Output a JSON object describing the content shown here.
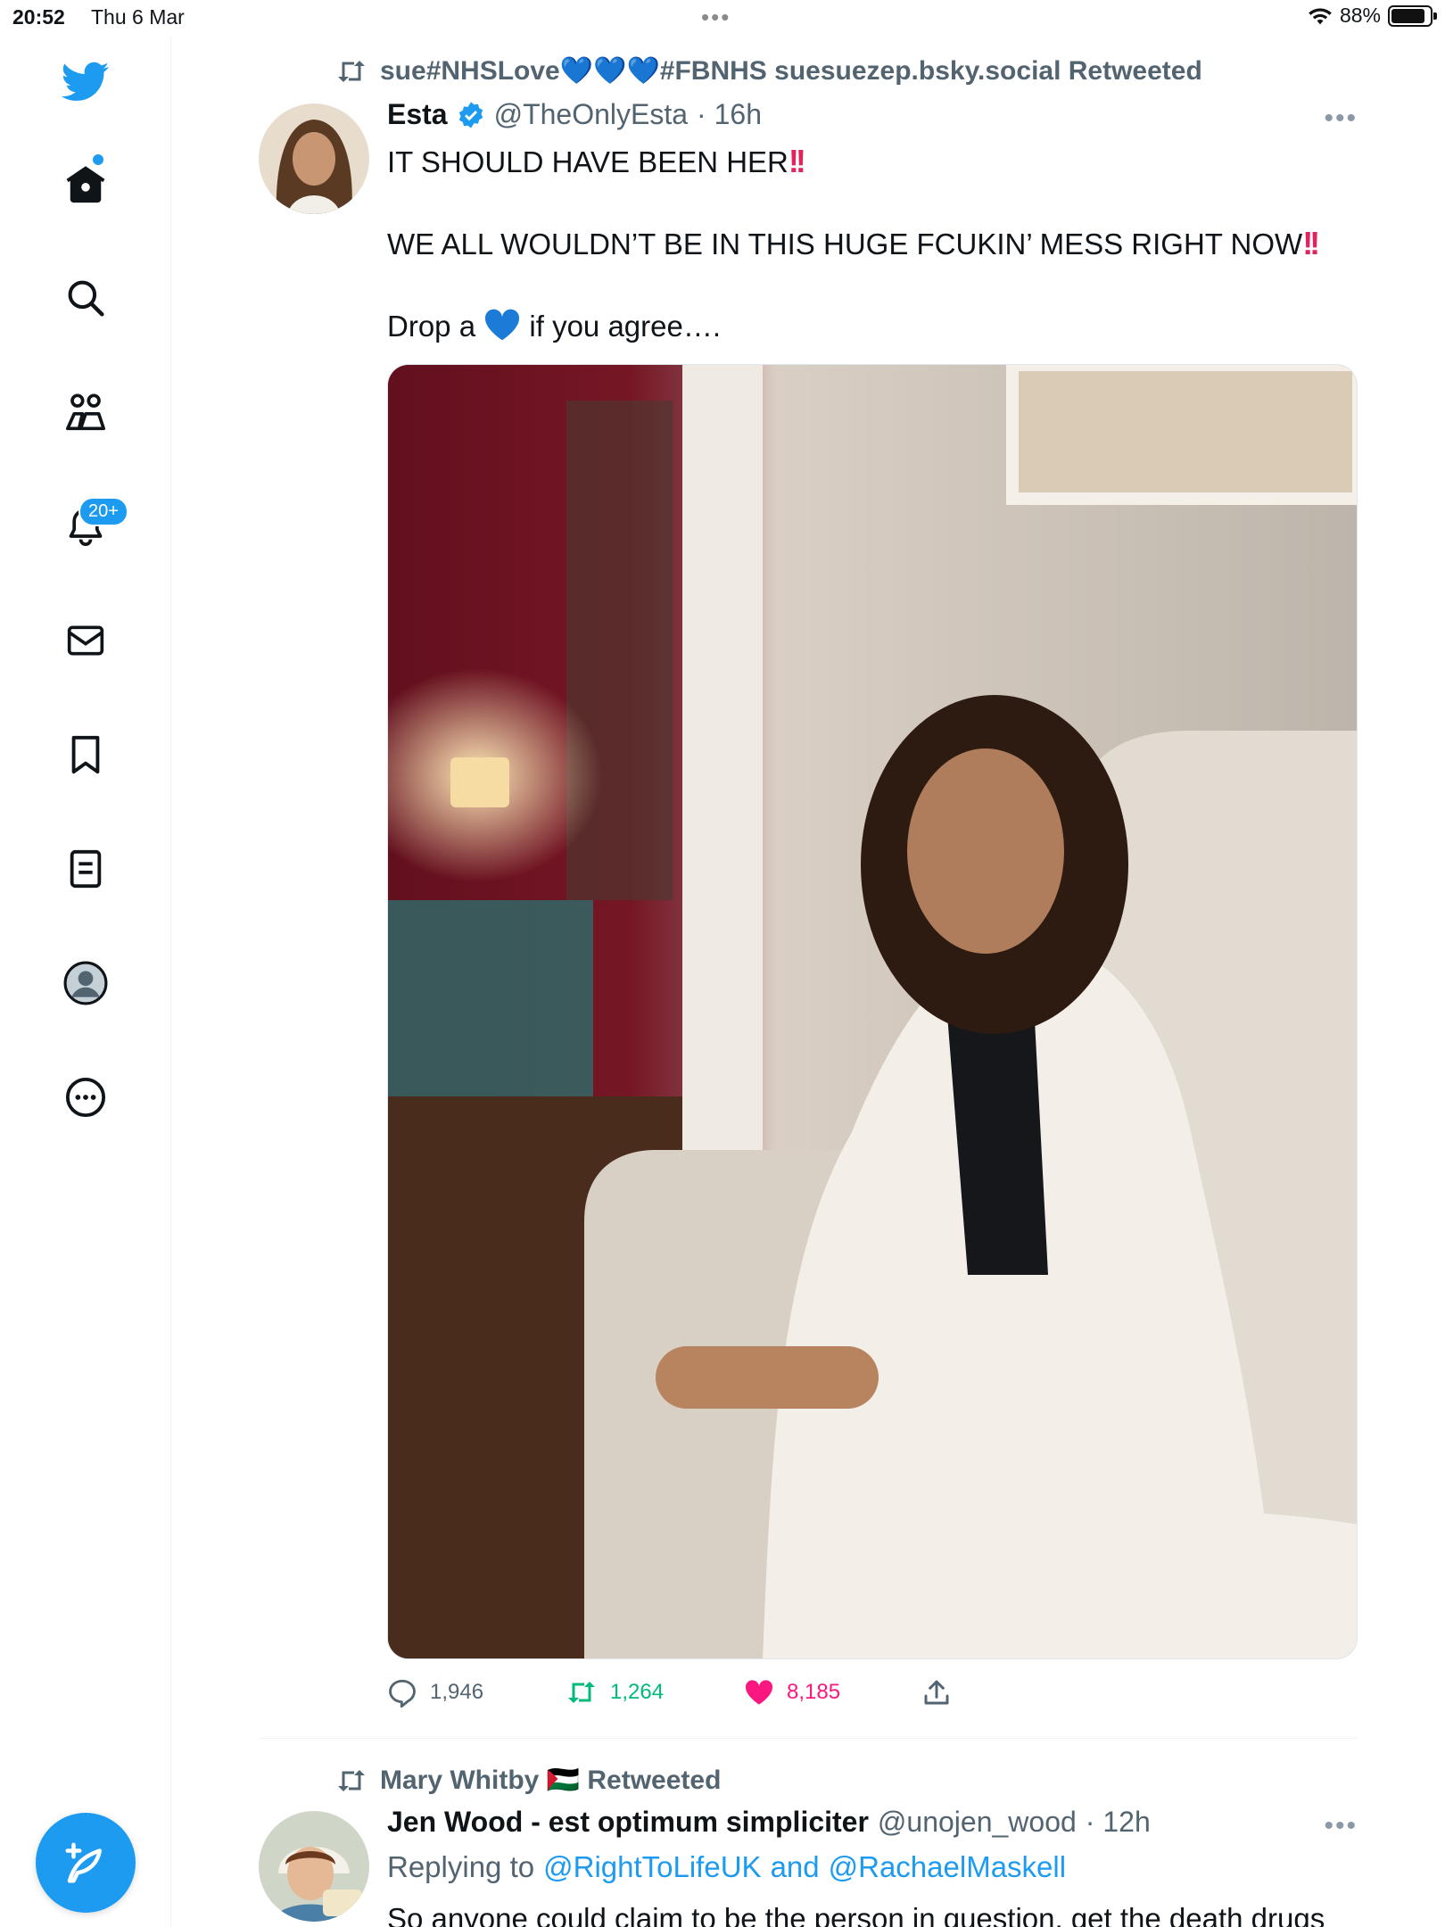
{
  "status_bar": {
    "time": "20:52",
    "date": "Thu 6 Mar",
    "battery": "88%",
    "battery_level": 0.88
  },
  "sidebar": {
    "notifications_badge": "20+",
    "items": [
      "home-icon",
      "search-icon",
      "communities-icon",
      "notifications-icon",
      "messages-icon",
      "bookmarks-icon",
      "lists-icon",
      "profile-icon",
      "more-icon"
    ]
  },
  "tweets": [
    {
      "retweeted_by": "sue#NHSLove💙💙💙#FBNHS suesuezep.bsky.social Retweeted",
      "name": "Esta",
      "handle": "@TheOnlyEsta",
      "time": "· 16h",
      "line1": "IT SHOULD HAVE BEEN HER",
      "line2": "WE ALL WOULDN’T BE IN THIS HUGE FCUKIN’ MESS RIGHT NOW",
      "line3_a": "Drop a",
      "line3_b": "if you agree….",
      "replies": "1,946",
      "retweets": "1,264",
      "likes": "8,185"
    },
    {
      "retweeted_by": "Mary Whitby 🇵🇸 Retweeted",
      "name": "Jen Wood - est optimum simpliciter",
      "handle": "@unojen_wood",
      "time": "· 12h",
      "replying_prefix": "Replying to",
      "replying_to_1": "@RightToLifeUK",
      "replying_and": "and",
      "replying_to_2": "@RachaelMaskell",
      "text": "So anyone could claim to be the person in question, get the death drugs"
    }
  ],
  "colors": {
    "accent": "#1d9bf0",
    "retweet": "#00ba7c",
    "like": "#f91880"
  }
}
